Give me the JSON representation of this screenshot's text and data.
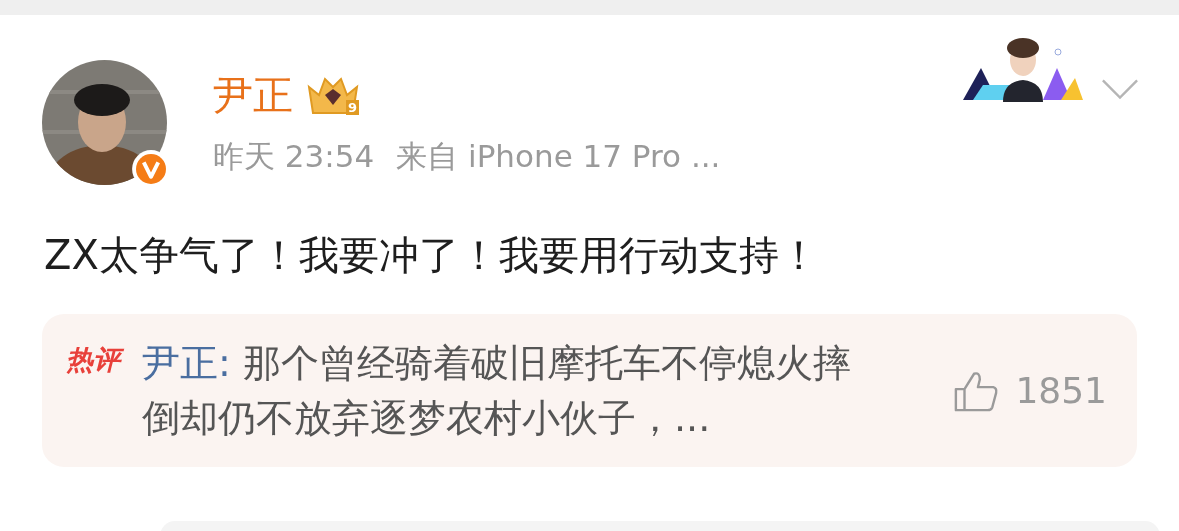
{
  "post": {
    "author": "尹正",
    "verified": true,
    "badge_level": "9",
    "time": "昨天 23:54",
    "source": "来自 iPhone 17 Pro ...",
    "text": "ZX太争气了！我要冲了！我要用行动支持！"
  },
  "hot_comment": {
    "tag": "热评",
    "author": "尹正:",
    "text": "那个曾经骑着破旧摩托车不停熄火摔倒却仍不放弃逐梦农村小伙子，...",
    "likes": "1851"
  }
}
